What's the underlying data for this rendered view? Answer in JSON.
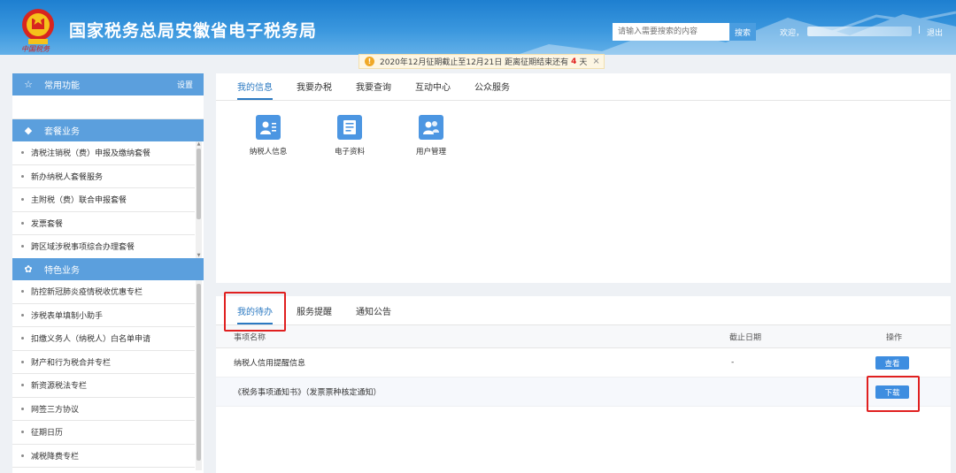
{
  "header": {
    "title": "国家税务总局安徽省电子税务局",
    "emblem_caption": "中国税务",
    "search_placeholder": "请输入需要搜索的内容",
    "search_button": "搜索",
    "welcome": "欢迎，",
    "separator": "|",
    "logout": "退出",
    "colors": {
      "bg_top": "#1e7fd0",
      "bg_bottom": "#63b0e8"
    }
  },
  "notice": {
    "icon": "warning-icon",
    "text_before": "2020年12月征期截止至12月21日 距离征期结束还有",
    "days": "4",
    "text_after": "天",
    "close": "×"
  },
  "sidebar": {
    "common": {
      "icon": "star-icon",
      "title": "常用功能",
      "setting": "设置"
    },
    "package": {
      "icon": "cube-icon",
      "title": "套餐业务",
      "items": [
        "清税注销税（费）申报及缴纳套餐",
        "新办纳税人套餐服务",
        "主附税（费）联合申报套餐",
        "发票套餐",
        "跨区域涉税事项综合办理套餐"
      ]
    },
    "special": {
      "icon": "clover-icon",
      "title": "特色业务",
      "items": [
        "防控新冠肺炎疫情税收优惠专栏",
        "涉税表单填制小助手",
        "扣缴义务人（纳税人）白名单申请",
        "财产和行为税合并专栏",
        "新资源税法专栏",
        "网签三方协议",
        "征期日历",
        "减税降费专栏"
      ]
    }
  },
  "top_panel": {
    "tabs": [
      "我的信息",
      "我要办税",
      "我要查询",
      "互动中心",
      "公众服务"
    ],
    "active_tab": 0,
    "apps": [
      {
        "label": "纳税人信息",
        "icon": "taxpayer-card-icon"
      },
      {
        "label": "电子资料",
        "icon": "document-icon"
      },
      {
        "label": "用户管理",
        "icon": "users-icon"
      }
    ]
  },
  "bottom_panel": {
    "tabs": [
      "我的待办",
      "服务提醒",
      "通知公告"
    ],
    "active_tab": 0,
    "columns": {
      "name": "事项名称",
      "deadline": "截止日期",
      "action": "操作"
    },
    "rows": [
      {
        "name": "纳税人信用提醒信息",
        "deadline": "-",
        "action": "查看"
      },
      {
        "name": "《税务事项通知书》（发票票种核定通知）",
        "deadline": "",
        "action": "下载"
      }
    ]
  }
}
